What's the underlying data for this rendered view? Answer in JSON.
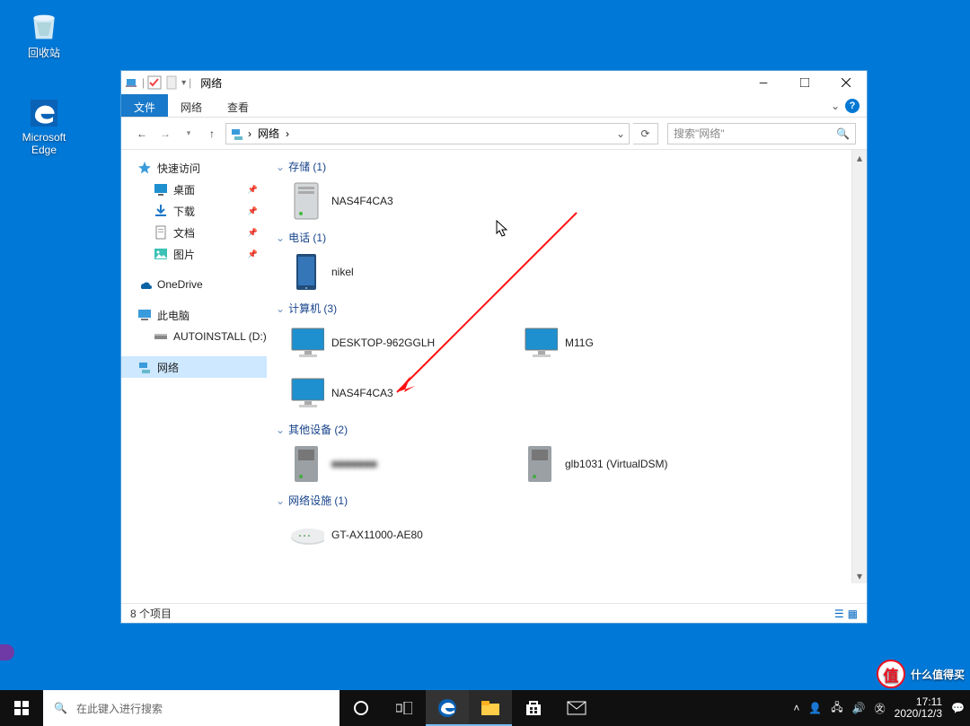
{
  "desktop": {
    "recycle_bin": "回收站",
    "edge_l1": "Microsoft",
    "edge_l2": "Edge"
  },
  "window": {
    "title": "网络",
    "tabs": {
      "file": "文件",
      "network": "网络",
      "view": "查看"
    },
    "address": {
      "crumb": "网络"
    },
    "search_placeholder": "搜索\"网络\"",
    "nav": {
      "quick_access": "快速访问",
      "desktop": "桌面",
      "downloads": "下载",
      "documents": "文档",
      "pictures": "图片",
      "onedrive": "OneDrive",
      "this_pc": "此电脑",
      "autoinstall": "AUTOINSTALL (D:)",
      "network": "网络"
    },
    "sections": {
      "storage": "存储 (1)",
      "phone": "电话 (1)",
      "computer": "计算机 (3)",
      "other": "其他设备 (2)",
      "infra": "网络设施 (1)"
    },
    "devices": {
      "nas1": "NAS4F4CA3",
      "nikel": "nikel",
      "desktop962": "DESKTOP-962GGLH",
      "m11g": "M11G",
      "nas2": "NAS4F4CA3",
      "other_blurred": "■■■■■■■",
      "glb": "glb1031 (VirtualDSM)",
      "router": "GT-AX11000-AE80"
    },
    "status": "8 个项目"
  },
  "taskbar": {
    "search_placeholder": "在此键入进行搜索",
    "time": "17:11",
    "date": "2020/12/3"
  },
  "watermark": "什么值得买"
}
